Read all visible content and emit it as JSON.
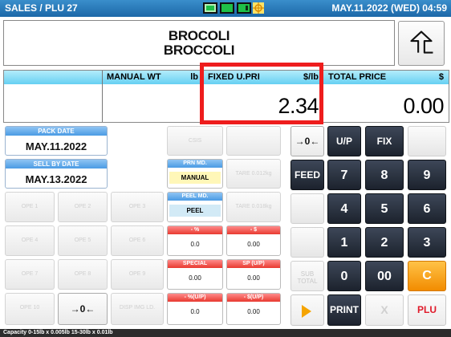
{
  "header": {
    "title": "SALES / PLU 27",
    "datetime": "MAY.11.2022 (WED) 04:59",
    "colors": {
      "bar": "#2272b5",
      "indicator": "#24c84a"
    }
  },
  "item": {
    "name_line1": "BROCOLI",
    "name_line2": "BROCCOLI"
  },
  "strip": {
    "manual_wt": {
      "label": "MANUAL WT",
      "unit": "lb",
      "value": ""
    },
    "fixed_upri": {
      "label": "FIXED U.PRI",
      "unit": "$/lb",
      "value": "2.34"
    },
    "total_price": {
      "label": "TOTAL PRICE",
      "unit": "$",
      "value": "0.00"
    }
  },
  "dates": {
    "pack": {
      "label": "PACK DATE",
      "value": "MAY.11.2022"
    },
    "sell_by": {
      "label": "SELL BY DATE",
      "value": "MAY.13.2022"
    }
  },
  "keys": {
    "csis": "CSIS",
    "prn_md": {
      "label": "PRN MD.",
      "value": "MANUAL"
    },
    "peel_md": {
      "label": "PEEL MD.",
      "value": "PEEL"
    },
    "tare1": "TARE 0.012kg",
    "tare2": "TARE 0.018kg",
    "ope": [
      "OPE 1",
      "OPE 2",
      "OPE 3",
      "OPE 4",
      "OPE 5",
      "OPE 6",
      "OPE 7",
      "OPE 8",
      "OPE 9",
      "OPE 10"
    ],
    "pct": {
      "label": "- %",
      "value": "0.0"
    },
    "dollar": {
      "label": "- $",
      "value": "0.00"
    },
    "special": {
      "label": "SPECIAL",
      "value": "0.00"
    },
    "sp_up": {
      "label": "SP (U/P)",
      "value": "0.00"
    },
    "pct_up": {
      "label": "- %(U/P)",
      "value": "0.0"
    },
    "dollar_up": {
      "label": "- $(U/P)",
      "value": "0.00"
    },
    "disp_img": "DISP IMG LD.",
    "zero_symbol": "→0←",
    "up": "U/P",
    "fix": "FIX",
    "feed": "FEED",
    "digits": [
      "7",
      "8",
      "9",
      "4",
      "5",
      "6",
      "1",
      "2",
      "3",
      "0",
      "00"
    ],
    "clear": "C",
    "sub_total": "SUB TOTAL",
    "print": "PRINT",
    "x": "X",
    "plu": "PLU"
  },
  "status": {
    "capacity": "Capacity 0-15lb x 0.005lb  15-30lb x 0.01lb"
  }
}
